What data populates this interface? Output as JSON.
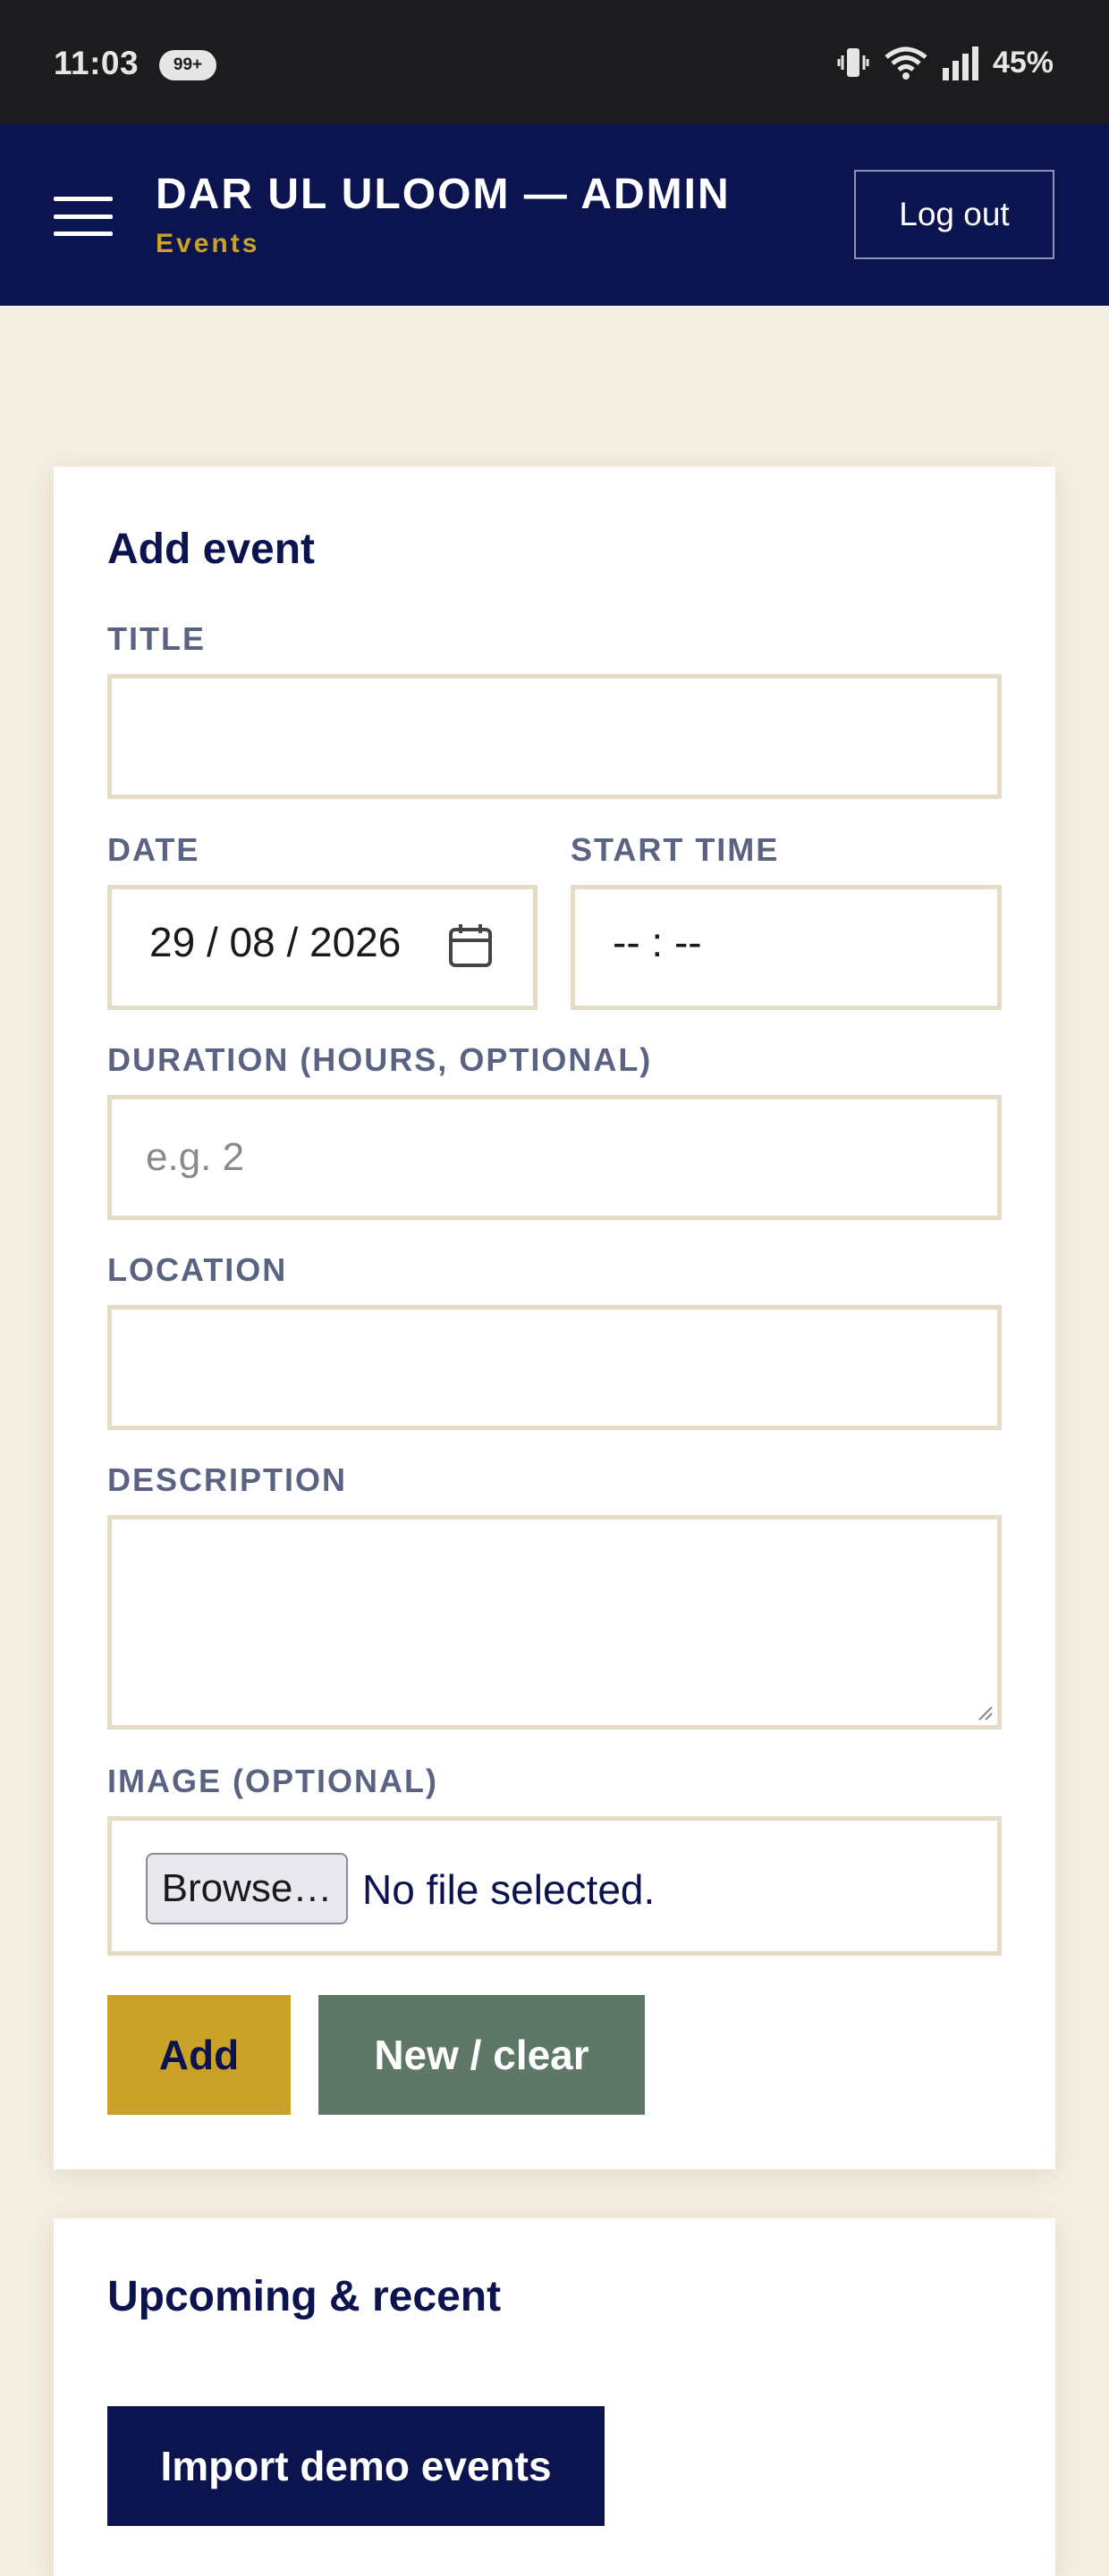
{
  "status_bar": {
    "time": "11:03",
    "notification_badge": "99+",
    "battery": "45%",
    "icons": [
      "vibrate-icon",
      "wifi-icon",
      "signal-icon"
    ]
  },
  "header": {
    "title": "DAR UL ULOOM — ADMIN",
    "subtitle": "Events",
    "logout_label": "Log out",
    "colors": {
      "background": "#0c1450",
      "accent": "#c9a227"
    }
  },
  "add_event": {
    "heading": "Add event",
    "title_label": "TITLE",
    "title_value": "",
    "date_label": "DATE",
    "date_value": "29 / 08 / 2026",
    "start_time_label": "START TIME",
    "start_time_value": "-- : --",
    "duration_label": "DURATION (HOURS, OPTIONAL)",
    "duration_placeholder": "e.g. 2",
    "location_label": "LOCATION",
    "location_value": "",
    "description_label": "DESCRIPTION",
    "description_value": "",
    "image_label": "IMAGE (OPTIONAL)",
    "browse_label": "Browse…",
    "file_status": "No file selected.",
    "add_button": "Add",
    "clear_button": "New / clear"
  },
  "upcoming": {
    "heading": "Upcoming & recent",
    "import_button": "Import demo events"
  }
}
